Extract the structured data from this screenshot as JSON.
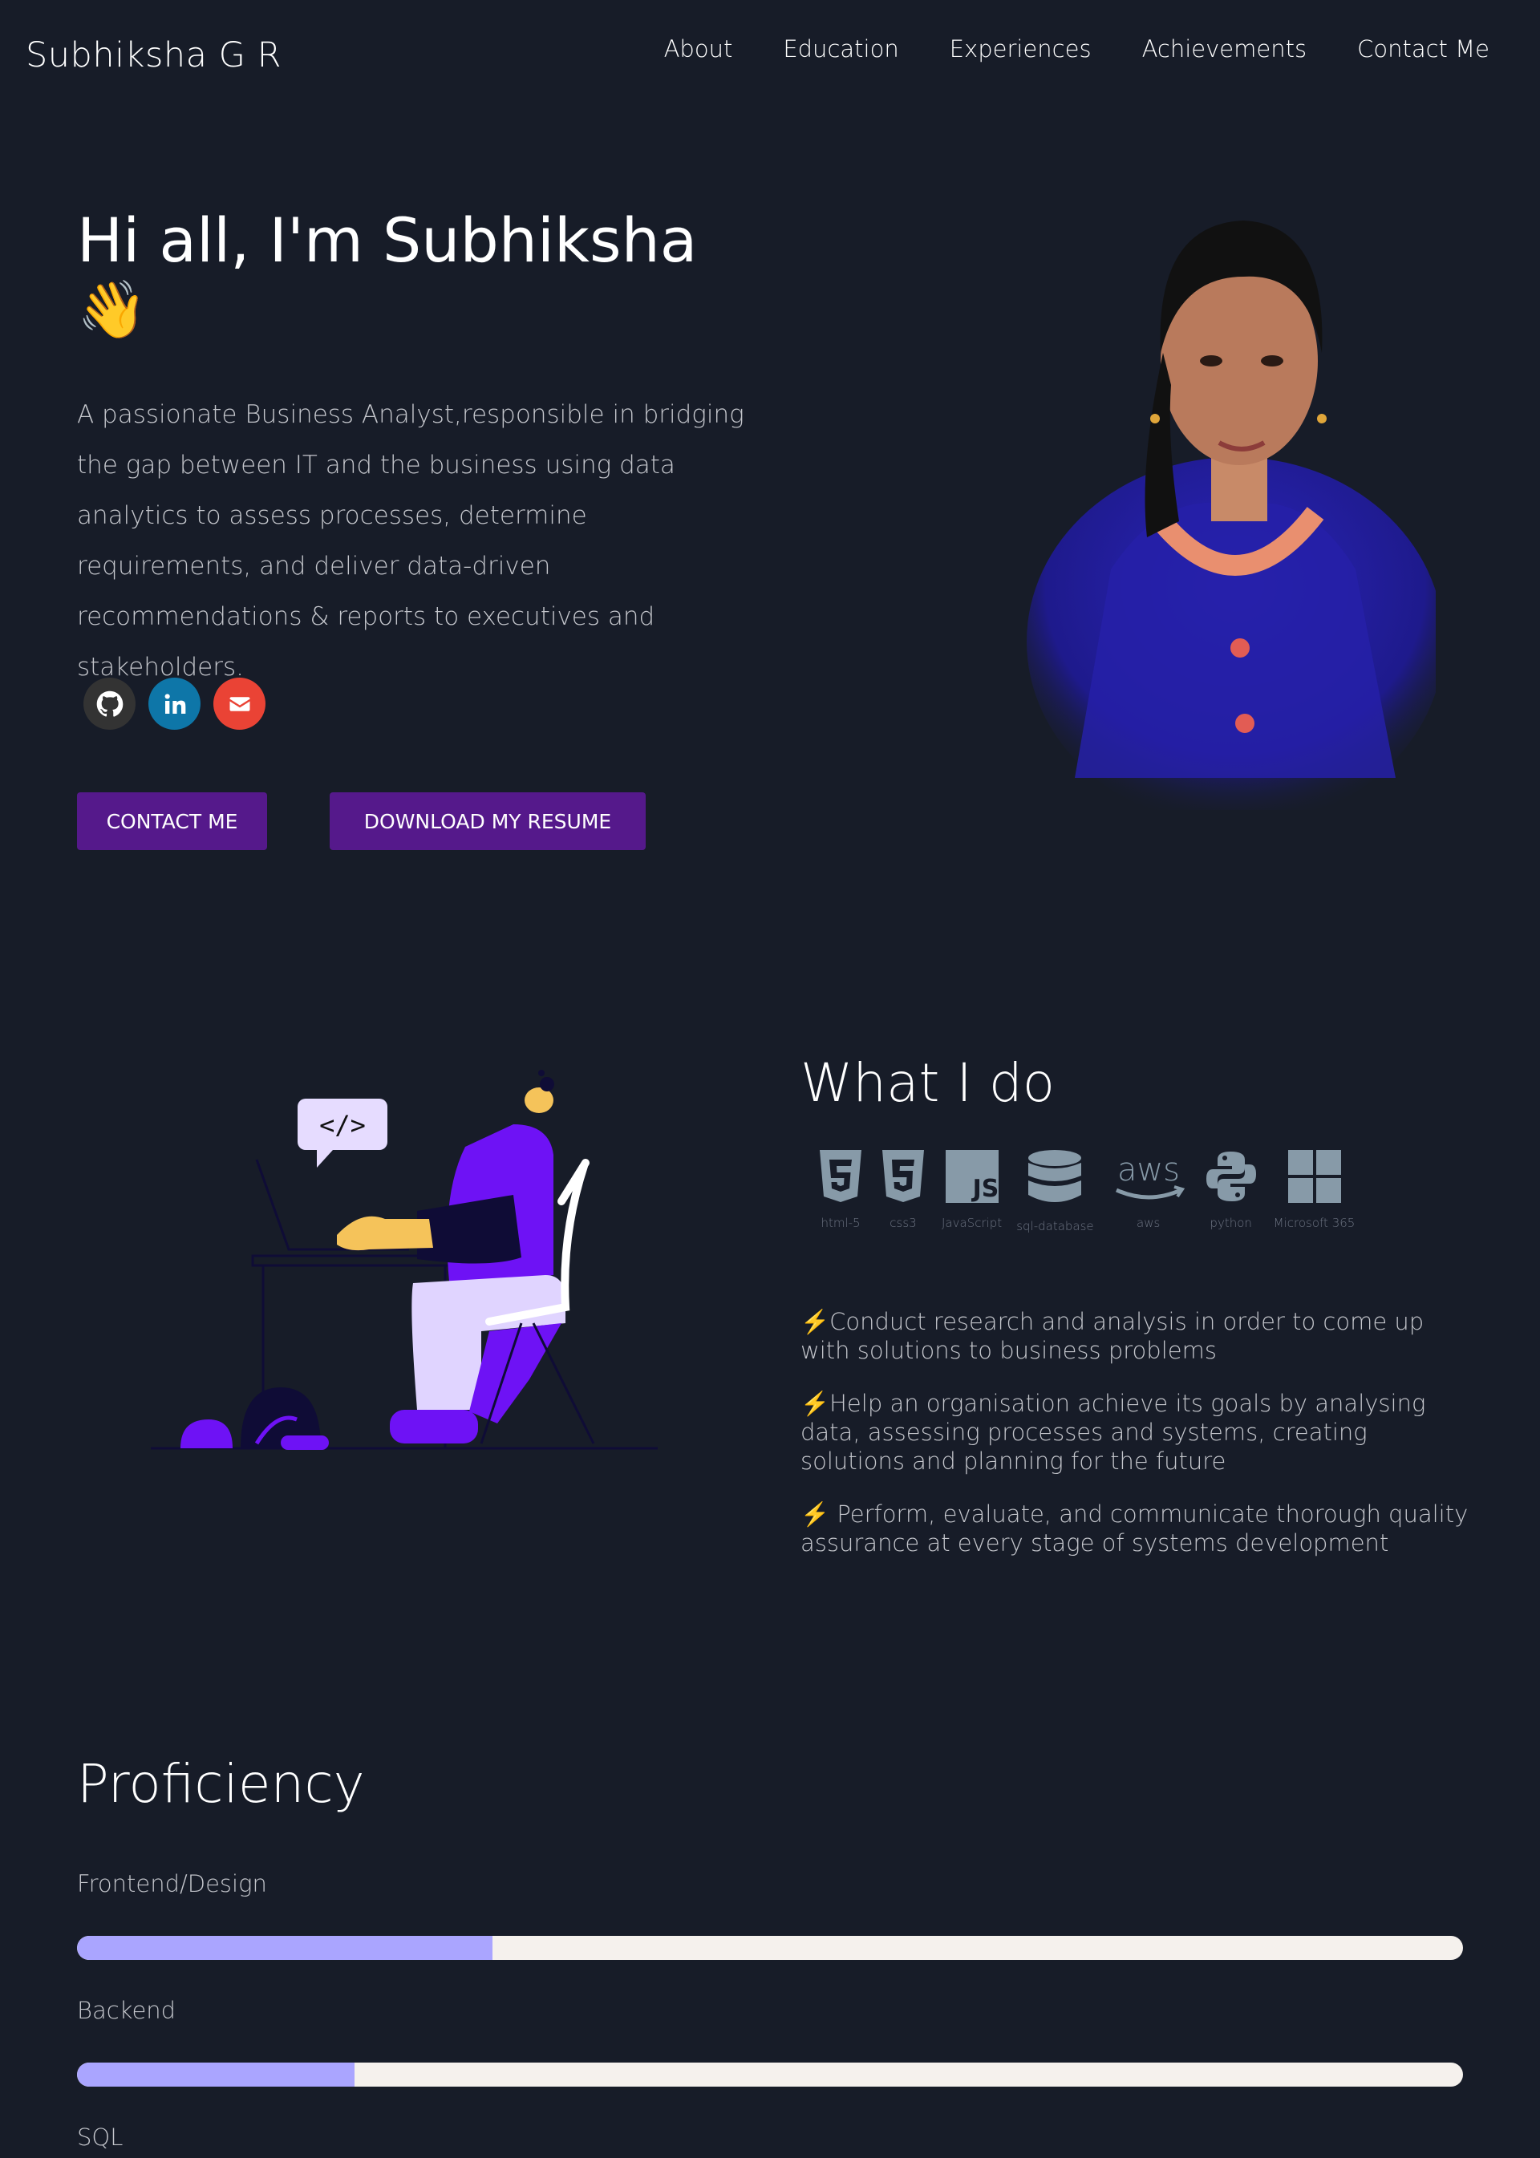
{
  "header": {
    "logo": "Subhiksha G R",
    "nav": [
      "About",
      "Education",
      "Experiences",
      "Achievements",
      "Contact Me"
    ]
  },
  "greeting": {
    "title": "Hi all, I'm Subhiksha",
    "wave": "👋",
    "subtitle": "A passionate Business Analyst,responsible in bridging the gap between IT and the business using data analytics to assess processes, determine requirements, and deliver data-driven recommendations & reports to executives and stakeholders.",
    "social_icons": [
      "github-icon",
      "linkedin-icon",
      "envelope-icon"
    ],
    "contact_button": "CONTACT ME",
    "resume_button": "DOWNLOAD MY RESUME",
    "colors": {
      "button": "#55198b",
      "github": "#333333",
      "linkedin": "#0e76a8",
      "email": "#ea4335"
    }
  },
  "what_i_do": {
    "title": "What I do",
    "skills": [
      {
        "name": "html-5",
        "icon": "html5-icon"
      },
      {
        "name": "css3",
        "icon": "css3-icon"
      },
      {
        "name": "JavaScript",
        "icon": "javascript-icon"
      },
      {
        "name": "sql-database",
        "icon": "database-icon"
      },
      {
        "name": "aws",
        "icon": "aws-icon"
      },
      {
        "name": "python",
        "icon": "python-icon"
      },
      {
        "name": "Microsoft 365",
        "icon": "windows-icon"
      }
    ],
    "bullets": [
      "⚡Conduct research and analysis in order to come up with solutions to business problems",
      "⚡Help an organisation achieve its goals by analysing data, assessing processes and systems, creating solutions and planning for the future",
      "⚡ Perform, evaluate, and communicate thorough quality assurance at every stage of systems development"
    ]
  },
  "proficiency": {
    "title": "Proficiency",
    "items": [
      {
        "label": "Frontend/Design",
        "percent": 30
      },
      {
        "label": "Backend",
        "percent": 20
      },
      {
        "label": "SQL"
      }
    ],
    "colors": {
      "fill": "#aaa5ff",
      "track": "#f5f1ed"
    }
  }
}
